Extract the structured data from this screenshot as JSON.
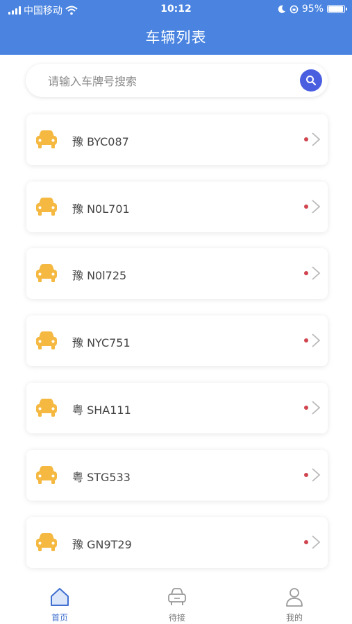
{
  "status_bar": {
    "carrier": "中国移动",
    "time": "10:12",
    "battery": "95%"
  },
  "header": {
    "title": "车辆列表"
  },
  "search": {
    "placeholder": "请输入车牌号搜索"
  },
  "vehicles": [
    {
      "plate": "豫 BYC087"
    },
    {
      "plate": "豫 N0L701"
    },
    {
      "plate": "豫 N0l725"
    },
    {
      "plate": "豫 NYC751"
    },
    {
      "plate": "粤 SHA111"
    },
    {
      "plate": "粤 STG533"
    },
    {
      "plate": "豫 GN9T29"
    }
  ],
  "tabbar": {
    "home": "首页",
    "pending": "待接",
    "mine": "我的"
  },
  "colors": {
    "header": "#4a84e0",
    "accent": "#3f6fcf",
    "car_icon": "#f5b841",
    "status_dot": "#d0454f"
  }
}
